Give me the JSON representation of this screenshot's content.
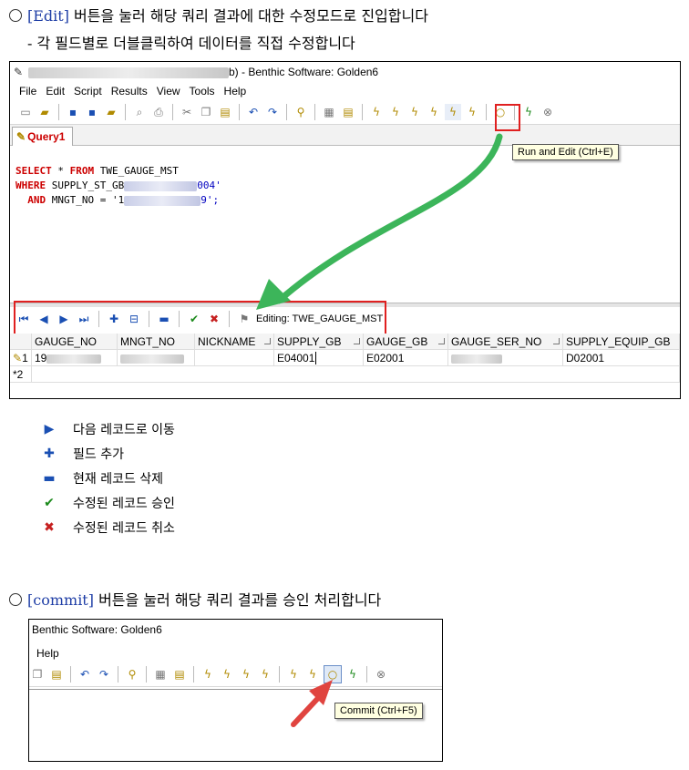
{
  "section1": {
    "line_prefix": "[",
    "keyword": "Edit",
    "line_suffix": "] 버튼을 눌러 해당 쿼리 결과에 대한 수정모드로 진입합니다",
    "sub_line": "- 각 필드별로 더블클릭하여 데이터를 직접 수정합니다"
  },
  "shot1": {
    "window_title": "b) - Benthic Software: Golden6",
    "menu": [
      "File",
      "Edit",
      "Script",
      "Results",
      "View",
      "Tools",
      "Help"
    ],
    "tab_label": "Query1",
    "sql_line1_kw1": "SELECT",
    "sql_line1_rest": " * ",
    "sql_line1_kw2": "FROM",
    "sql_line1_table": " TWE_GAUGE_MST",
    "sql_line2_kw": "WHERE",
    "sql_line2_rest": " SUPPLY_ST_GB",
    "sql_line2_end": "004'",
    "sql_line3_kw": "AND",
    "sql_line3_rest": " MNGT_NO = '1",
    "sql_line3_end": "9';",
    "tooltip": "Run and Edit (Ctrl+E)",
    "editing_label": "Editing: TWE_GAUGE_MST",
    "columns": [
      "GAUGE_NO",
      "MNGT_NO",
      "NICKNAME",
      "SUPPLY_GB",
      "GAUGE_GB",
      "GAUGE_SER_NO",
      "SUPPLY_EQUIP_GB"
    ],
    "row1_marker": "1",
    "row1": {
      "gauge_no": "19",
      "supply_gb": "E04001",
      "gauge_gb": "E02001",
      "supply_equip_gb": "D02001"
    },
    "row2_marker": "*2"
  },
  "legend": [
    {
      "icon": "next-record-icon",
      "label": "다음 레코드로 이동"
    },
    {
      "icon": "add-field-icon",
      "label": "필드 추가"
    },
    {
      "icon": "delete-record-icon",
      "label": "현재  레코드 삭제"
    },
    {
      "icon": "approve-icon",
      "label": "수정된  레코드 승인"
    },
    {
      "icon": "cancel-icon",
      "label": "수정된 레코드 취소"
    }
  ],
  "section2": {
    "line_prefix": "[",
    "keyword": "commit",
    "line_suffix": "] 버튼을 눌러 해당 쿼리 결과를 승인 처리합니다"
  },
  "shot2": {
    "window_title": "Benthic Software: Golden6",
    "menu": [
      "Help"
    ],
    "tooltip": "Commit (Ctrl+F5)"
  },
  "colors": {
    "accent_blue": "#1f3ea6",
    "highlight_red": "#e02020",
    "arrow_green": "#3cb55a"
  }
}
